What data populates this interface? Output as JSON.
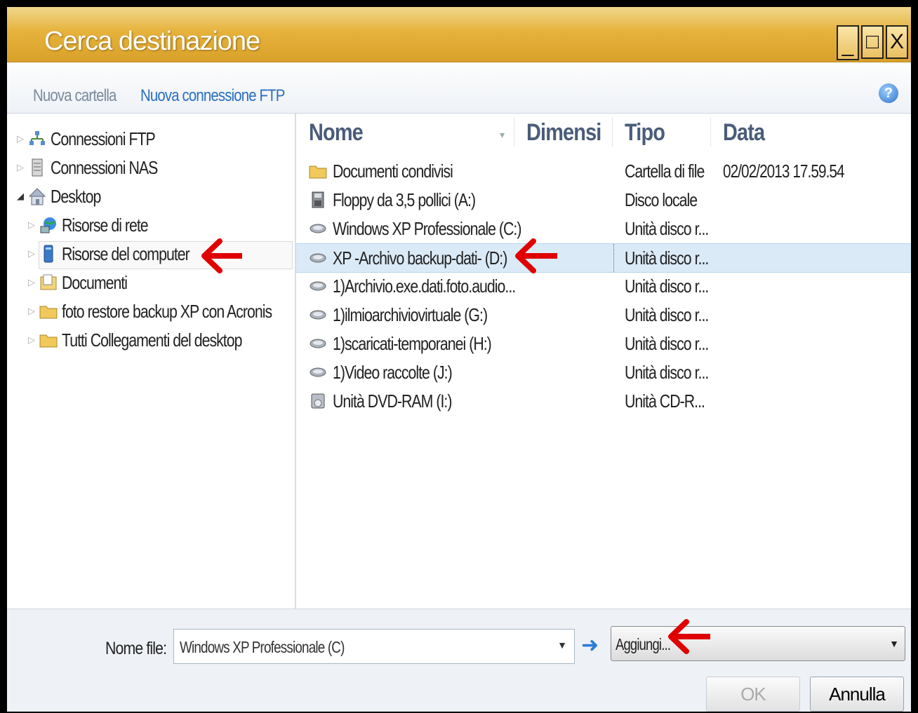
{
  "window": {
    "title": "Cerca destinazione",
    "min": "_",
    "max": "□",
    "close": "X"
  },
  "toolbar": {
    "new_folder": "Nuova cartella",
    "new_ftp": "Nuova connessione FTP",
    "help": "?"
  },
  "tree": [
    {
      "label": "Connessioni FTP",
      "icon": "network-icon"
    },
    {
      "label": "Connessioni NAS",
      "icon": "server-icon"
    },
    {
      "label": "Desktop",
      "icon": "home-icon"
    },
    {
      "label": "Risorse di rete",
      "icon": "globe-network-icon"
    },
    {
      "label": "Risorse del computer",
      "icon": "computer-icon"
    },
    {
      "label": "Documenti",
      "icon": "documents-icon"
    },
    {
      "label": "foto restore backup XP con Acronis",
      "icon": "folder-icon"
    },
    {
      "label": "Tutti Collegamenti del desktop",
      "icon": "folder-icon"
    }
  ],
  "columns": {
    "name": "Nome",
    "size": "Dimensi",
    "type": "Tipo",
    "date": "Data"
  },
  "files": [
    {
      "name": "Documenti condivisi",
      "type": "Cartella di file",
      "date": "02/02/2013 17.59.54",
      "icon": "folder-icon"
    },
    {
      "name": "Floppy da 3,5 pollici (A:)",
      "type": "Disco locale",
      "date": "",
      "icon": "floppy-icon"
    },
    {
      "name": "Windows XP Professionale (C:)",
      "type": "Unità disco r...",
      "date": "",
      "icon": "drive-icon"
    },
    {
      "name": "XP -Archivo backup-dati- (D:)",
      "type": "Unità disco r...",
      "date": "",
      "icon": "drive-icon"
    },
    {
      "name": "1)Archivio.exe.dati.foto.audio...",
      "type": "Unità disco r...",
      "date": "",
      "icon": "drive-icon"
    },
    {
      "name": "1)ilmioarchiviovirtuale (G:)",
      "type": "Unità disco r...",
      "date": "",
      "icon": "drive-icon"
    },
    {
      "name": "1)scaricati-temporanei (H:)",
      "type": "Unità disco r...",
      "date": "",
      "icon": "drive-icon"
    },
    {
      "name": "1)Video raccolte (J:)",
      "type": "Unità disco r...",
      "date": "",
      "icon": "drive-icon"
    },
    {
      "name": "Unità DVD-RAM (I:)",
      "type": "Unità CD-R...",
      "date": "",
      "icon": "dvd-icon"
    }
  ],
  "bottom": {
    "filename_label": "Nome file:",
    "filename_value": "Windows XP Professionale (C)",
    "filter_value": "Aggiungi...",
    "ok": "OK",
    "cancel": "Annulla"
  },
  "colors": {
    "title_bar": "#e6b23b",
    "annotation_arrow": "#e00000",
    "selection": "#dbeaf7",
    "link": "#2a6fc0"
  }
}
